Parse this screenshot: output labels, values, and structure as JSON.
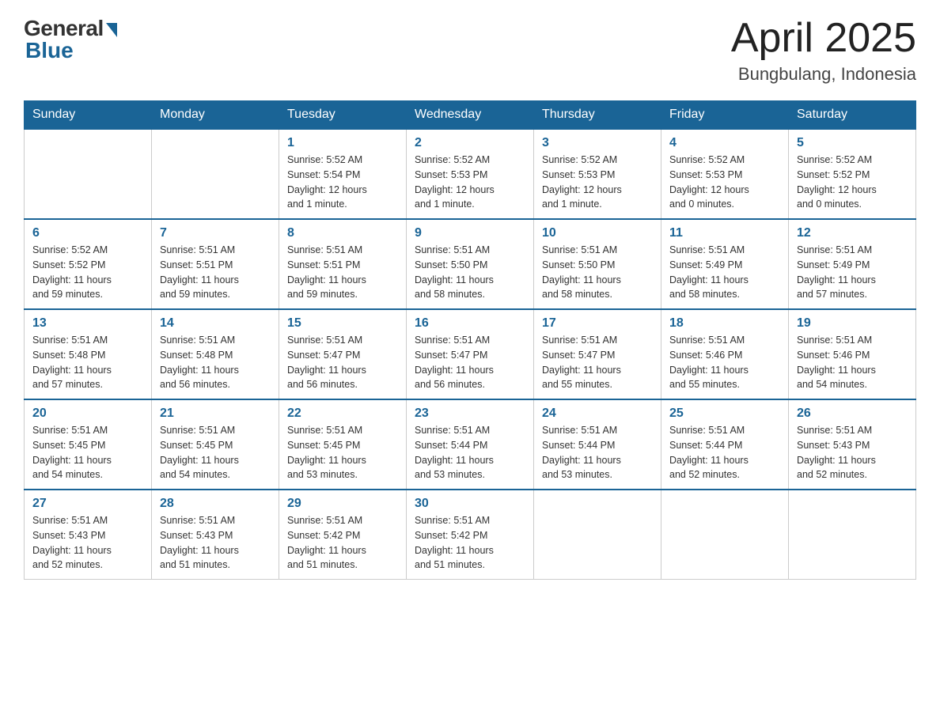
{
  "header": {
    "logo": {
      "general": "General",
      "blue": "Blue"
    },
    "title": "April 2025",
    "location": "Bungbulang, Indonesia"
  },
  "days_of_week": [
    "Sunday",
    "Monday",
    "Tuesday",
    "Wednesday",
    "Thursday",
    "Friday",
    "Saturday"
  ],
  "weeks": [
    [
      {
        "day": "",
        "info": ""
      },
      {
        "day": "",
        "info": ""
      },
      {
        "day": "1",
        "info": "Sunrise: 5:52 AM\nSunset: 5:54 PM\nDaylight: 12 hours\nand 1 minute."
      },
      {
        "day": "2",
        "info": "Sunrise: 5:52 AM\nSunset: 5:53 PM\nDaylight: 12 hours\nand 1 minute."
      },
      {
        "day": "3",
        "info": "Sunrise: 5:52 AM\nSunset: 5:53 PM\nDaylight: 12 hours\nand 1 minute."
      },
      {
        "day": "4",
        "info": "Sunrise: 5:52 AM\nSunset: 5:53 PM\nDaylight: 12 hours\nand 0 minutes."
      },
      {
        "day": "5",
        "info": "Sunrise: 5:52 AM\nSunset: 5:52 PM\nDaylight: 12 hours\nand 0 minutes."
      }
    ],
    [
      {
        "day": "6",
        "info": "Sunrise: 5:52 AM\nSunset: 5:52 PM\nDaylight: 11 hours\nand 59 minutes."
      },
      {
        "day": "7",
        "info": "Sunrise: 5:51 AM\nSunset: 5:51 PM\nDaylight: 11 hours\nand 59 minutes."
      },
      {
        "day": "8",
        "info": "Sunrise: 5:51 AM\nSunset: 5:51 PM\nDaylight: 11 hours\nand 59 minutes."
      },
      {
        "day": "9",
        "info": "Sunrise: 5:51 AM\nSunset: 5:50 PM\nDaylight: 11 hours\nand 58 minutes."
      },
      {
        "day": "10",
        "info": "Sunrise: 5:51 AM\nSunset: 5:50 PM\nDaylight: 11 hours\nand 58 minutes."
      },
      {
        "day": "11",
        "info": "Sunrise: 5:51 AM\nSunset: 5:49 PM\nDaylight: 11 hours\nand 58 minutes."
      },
      {
        "day": "12",
        "info": "Sunrise: 5:51 AM\nSunset: 5:49 PM\nDaylight: 11 hours\nand 57 minutes."
      }
    ],
    [
      {
        "day": "13",
        "info": "Sunrise: 5:51 AM\nSunset: 5:48 PM\nDaylight: 11 hours\nand 57 minutes."
      },
      {
        "day": "14",
        "info": "Sunrise: 5:51 AM\nSunset: 5:48 PM\nDaylight: 11 hours\nand 56 minutes."
      },
      {
        "day": "15",
        "info": "Sunrise: 5:51 AM\nSunset: 5:47 PM\nDaylight: 11 hours\nand 56 minutes."
      },
      {
        "day": "16",
        "info": "Sunrise: 5:51 AM\nSunset: 5:47 PM\nDaylight: 11 hours\nand 56 minutes."
      },
      {
        "day": "17",
        "info": "Sunrise: 5:51 AM\nSunset: 5:47 PM\nDaylight: 11 hours\nand 55 minutes."
      },
      {
        "day": "18",
        "info": "Sunrise: 5:51 AM\nSunset: 5:46 PM\nDaylight: 11 hours\nand 55 minutes."
      },
      {
        "day": "19",
        "info": "Sunrise: 5:51 AM\nSunset: 5:46 PM\nDaylight: 11 hours\nand 54 minutes."
      }
    ],
    [
      {
        "day": "20",
        "info": "Sunrise: 5:51 AM\nSunset: 5:45 PM\nDaylight: 11 hours\nand 54 minutes."
      },
      {
        "day": "21",
        "info": "Sunrise: 5:51 AM\nSunset: 5:45 PM\nDaylight: 11 hours\nand 54 minutes."
      },
      {
        "day": "22",
        "info": "Sunrise: 5:51 AM\nSunset: 5:45 PM\nDaylight: 11 hours\nand 53 minutes."
      },
      {
        "day": "23",
        "info": "Sunrise: 5:51 AM\nSunset: 5:44 PM\nDaylight: 11 hours\nand 53 minutes."
      },
      {
        "day": "24",
        "info": "Sunrise: 5:51 AM\nSunset: 5:44 PM\nDaylight: 11 hours\nand 53 minutes."
      },
      {
        "day": "25",
        "info": "Sunrise: 5:51 AM\nSunset: 5:44 PM\nDaylight: 11 hours\nand 52 minutes."
      },
      {
        "day": "26",
        "info": "Sunrise: 5:51 AM\nSunset: 5:43 PM\nDaylight: 11 hours\nand 52 minutes."
      }
    ],
    [
      {
        "day": "27",
        "info": "Sunrise: 5:51 AM\nSunset: 5:43 PM\nDaylight: 11 hours\nand 52 minutes."
      },
      {
        "day": "28",
        "info": "Sunrise: 5:51 AM\nSunset: 5:43 PM\nDaylight: 11 hours\nand 51 minutes."
      },
      {
        "day": "29",
        "info": "Sunrise: 5:51 AM\nSunset: 5:42 PM\nDaylight: 11 hours\nand 51 minutes."
      },
      {
        "day": "30",
        "info": "Sunrise: 5:51 AM\nSunset: 5:42 PM\nDaylight: 11 hours\nand 51 minutes."
      },
      {
        "day": "",
        "info": ""
      },
      {
        "day": "",
        "info": ""
      },
      {
        "day": "",
        "info": ""
      }
    ]
  ]
}
